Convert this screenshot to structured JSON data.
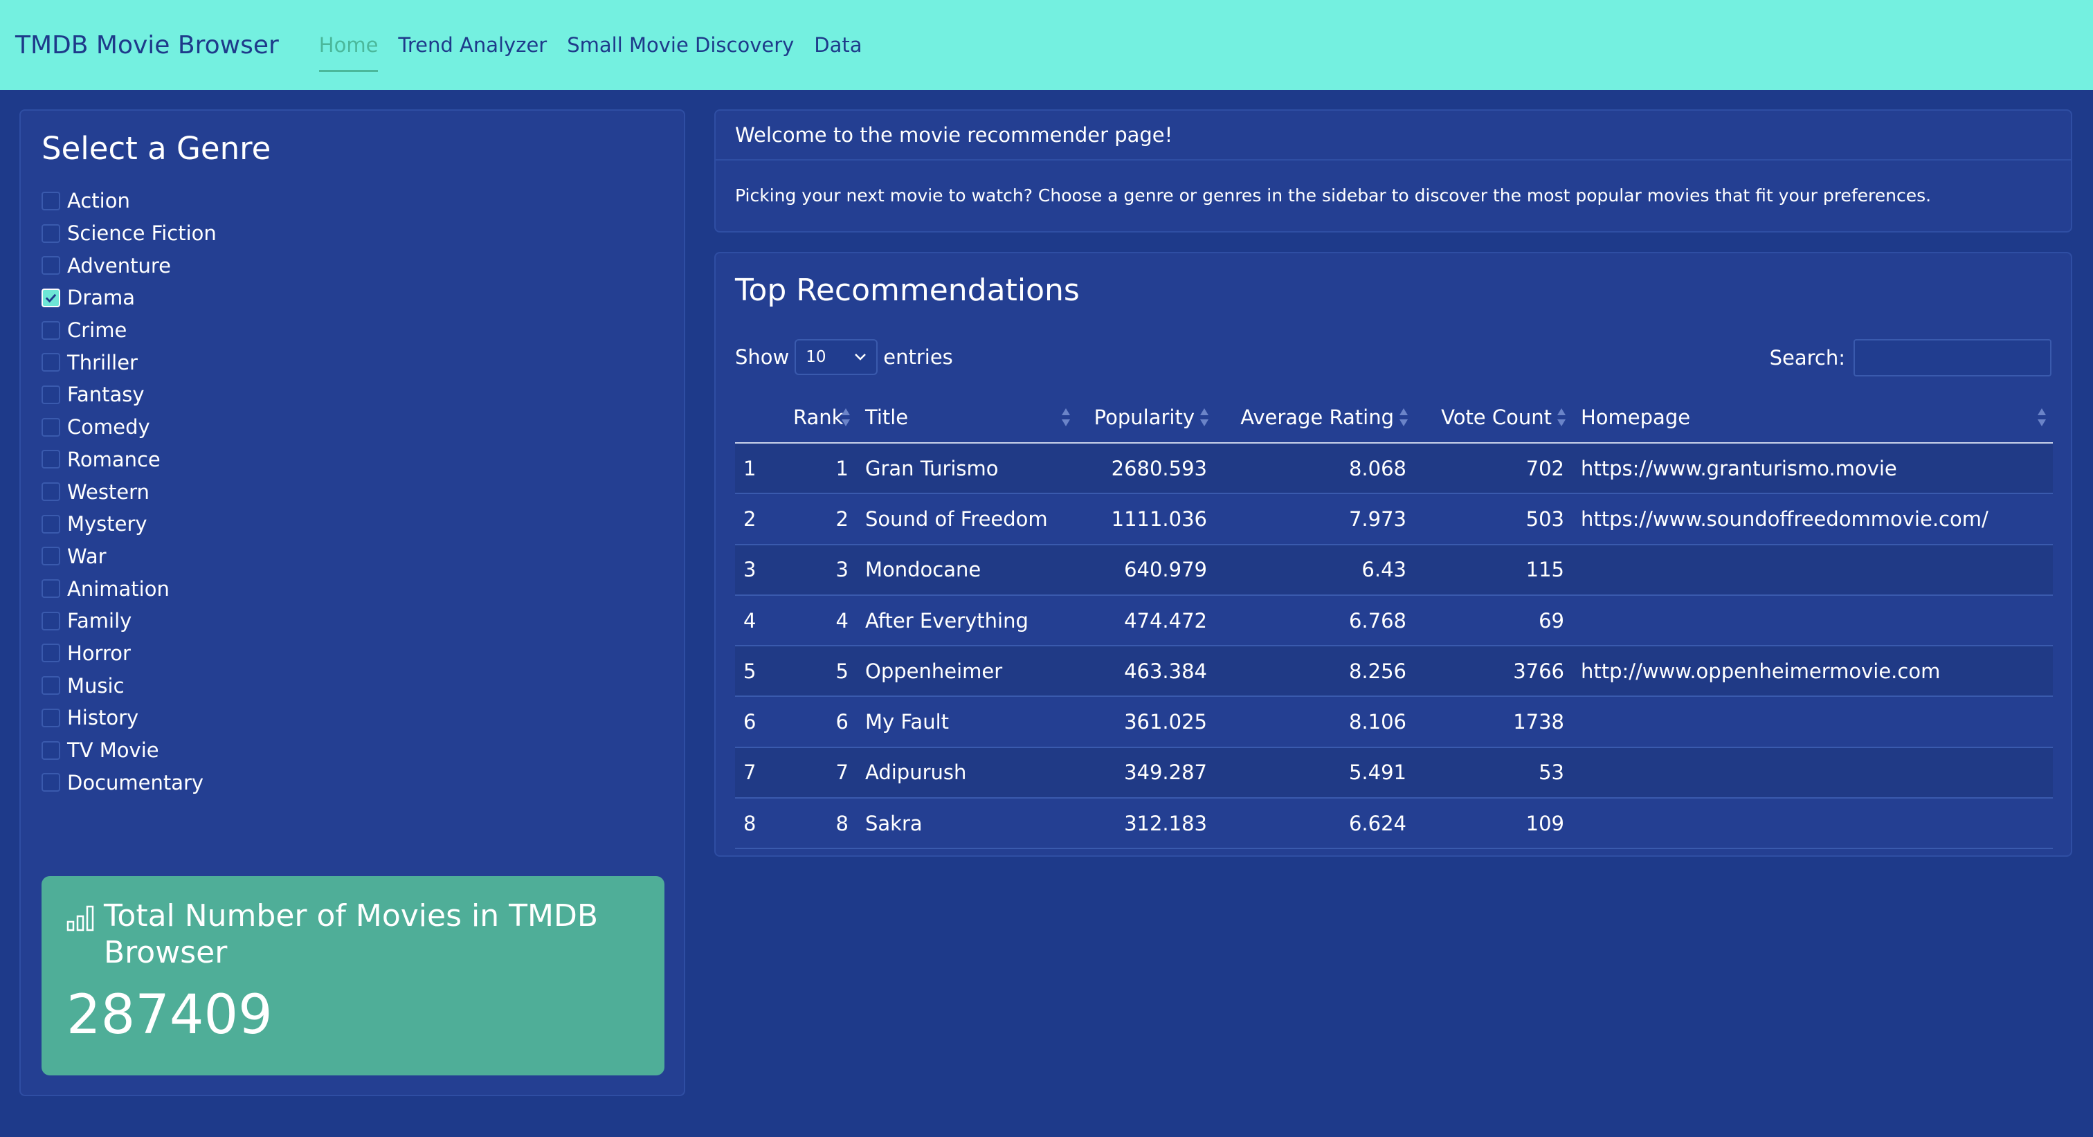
{
  "navbar": {
    "brand": "TMDB Movie Browser",
    "links": [
      "Home",
      "Trend Analyzer",
      "Small Movie Discovery",
      "Data"
    ],
    "active_color": "#4bb89b",
    "background": "#74f0e0"
  },
  "sidebar": {
    "title": "Select a Genre",
    "genres": [
      {
        "label": "Action",
        "checked": false
      },
      {
        "label": "Science Fiction",
        "checked": false
      },
      {
        "label": "Adventure",
        "checked": false
      },
      {
        "label": "Drama",
        "checked": true
      },
      {
        "label": "Crime",
        "checked": false
      },
      {
        "label": "Thriller",
        "checked": false
      },
      {
        "label": "Fantasy",
        "checked": false
      },
      {
        "label": "Comedy",
        "checked": false
      },
      {
        "label": "Romance",
        "checked": false
      },
      {
        "label": "Western",
        "checked": false
      },
      {
        "label": "Mystery",
        "checked": false
      },
      {
        "label": "War",
        "checked": false
      },
      {
        "label": "Animation",
        "checked": false
      },
      {
        "label": "Family",
        "checked": false
      },
      {
        "label": "Horror",
        "checked": false
      },
      {
        "label": "Music",
        "checked": false
      },
      {
        "label": "History",
        "checked": false
      },
      {
        "label": "TV Movie",
        "checked": false
      },
      {
        "label": "Documentary",
        "checked": false
      }
    ],
    "value_box": {
      "icon": "bar-chart-icon",
      "title": "Total Number of Movies in TMDB Browser",
      "value": "287409",
      "color": "#4fae98"
    }
  },
  "welcome": {
    "header": "Welcome to the movie recommender page!",
    "body": "Picking your next movie to watch? Choose a genre or genres in the sidebar to discover the most popular movies that fit your preferences."
  },
  "recommendations": {
    "title": "Top Recommendations",
    "show_label": "Show",
    "entries_value": "10",
    "entries_label": "entries",
    "search_label": "Search:",
    "columns": [
      "",
      "Rank",
      "Title",
      "Popularity",
      "Average Rating",
      "Vote Count",
      "Homepage"
    ],
    "rows": [
      [
        "1",
        "1",
        "Gran Turismo",
        "2680.593",
        "8.068",
        "702",
        "https://www.granturismo.movie"
      ],
      [
        "2",
        "2",
        "Sound of Freedom",
        "1111.036",
        "7.973",
        "503",
        "https://www.soundoffreedommovie.com/"
      ],
      [
        "3",
        "3",
        "Mondocane",
        "640.979",
        "6.43",
        "115",
        ""
      ],
      [
        "4",
        "4",
        "After Everything",
        "474.472",
        "6.768",
        "69",
        ""
      ],
      [
        "5",
        "5",
        "Oppenheimer",
        "463.384",
        "8.256",
        "3766",
        "http://www.oppenheimermovie.com"
      ],
      [
        "6",
        "6",
        "My Fault",
        "361.025",
        "8.106",
        "1738",
        ""
      ],
      [
        "7",
        "7",
        "Adipurush",
        "349.287",
        "5.491",
        "53",
        ""
      ],
      [
        "8",
        "8",
        "Sakra",
        "312.183",
        "6.624",
        "109",
        ""
      ]
    ]
  }
}
